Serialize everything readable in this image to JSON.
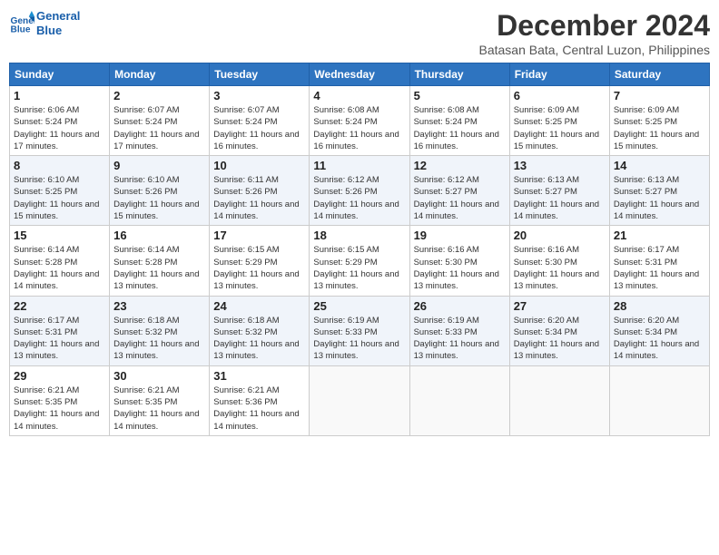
{
  "header": {
    "logo_line1": "General",
    "logo_line2": "Blue",
    "month_title": "December 2024",
    "subtitle": "Batasan Bata, Central Luzon, Philippines"
  },
  "weekdays": [
    "Sunday",
    "Monday",
    "Tuesday",
    "Wednesday",
    "Thursday",
    "Friday",
    "Saturday"
  ],
  "weeks": [
    [
      {
        "day": "1",
        "sunrise": "6:06 AM",
        "sunset": "5:24 PM",
        "daylight": "11 hours and 17 minutes."
      },
      {
        "day": "2",
        "sunrise": "6:07 AM",
        "sunset": "5:24 PM",
        "daylight": "11 hours and 17 minutes."
      },
      {
        "day": "3",
        "sunrise": "6:07 AM",
        "sunset": "5:24 PM",
        "daylight": "11 hours and 16 minutes."
      },
      {
        "day": "4",
        "sunrise": "6:08 AM",
        "sunset": "5:24 PM",
        "daylight": "11 hours and 16 minutes."
      },
      {
        "day": "5",
        "sunrise": "6:08 AM",
        "sunset": "5:24 PM",
        "daylight": "11 hours and 16 minutes."
      },
      {
        "day": "6",
        "sunrise": "6:09 AM",
        "sunset": "5:25 PM",
        "daylight": "11 hours and 15 minutes."
      },
      {
        "day": "7",
        "sunrise": "6:09 AM",
        "sunset": "5:25 PM",
        "daylight": "11 hours and 15 minutes."
      }
    ],
    [
      {
        "day": "8",
        "sunrise": "6:10 AM",
        "sunset": "5:25 PM",
        "daylight": "11 hours and 15 minutes."
      },
      {
        "day": "9",
        "sunrise": "6:10 AM",
        "sunset": "5:26 PM",
        "daylight": "11 hours and 15 minutes."
      },
      {
        "day": "10",
        "sunrise": "6:11 AM",
        "sunset": "5:26 PM",
        "daylight": "11 hours and 14 minutes."
      },
      {
        "day": "11",
        "sunrise": "6:12 AM",
        "sunset": "5:26 PM",
        "daylight": "11 hours and 14 minutes."
      },
      {
        "day": "12",
        "sunrise": "6:12 AM",
        "sunset": "5:27 PM",
        "daylight": "11 hours and 14 minutes."
      },
      {
        "day": "13",
        "sunrise": "6:13 AM",
        "sunset": "5:27 PM",
        "daylight": "11 hours and 14 minutes."
      },
      {
        "day": "14",
        "sunrise": "6:13 AM",
        "sunset": "5:27 PM",
        "daylight": "11 hours and 14 minutes."
      }
    ],
    [
      {
        "day": "15",
        "sunrise": "6:14 AM",
        "sunset": "5:28 PM",
        "daylight": "11 hours and 14 minutes."
      },
      {
        "day": "16",
        "sunrise": "6:14 AM",
        "sunset": "5:28 PM",
        "daylight": "11 hours and 13 minutes."
      },
      {
        "day": "17",
        "sunrise": "6:15 AM",
        "sunset": "5:29 PM",
        "daylight": "11 hours and 13 minutes."
      },
      {
        "day": "18",
        "sunrise": "6:15 AM",
        "sunset": "5:29 PM",
        "daylight": "11 hours and 13 minutes."
      },
      {
        "day": "19",
        "sunrise": "6:16 AM",
        "sunset": "5:30 PM",
        "daylight": "11 hours and 13 minutes."
      },
      {
        "day": "20",
        "sunrise": "6:16 AM",
        "sunset": "5:30 PM",
        "daylight": "11 hours and 13 minutes."
      },
      {
        "day": "21",
        "sunrise": "6:17 AM",
        "sunset": "5:31 PM",
        "daylight": "11 hours and 13 minutes."
      }
    ],
    [
      {
        "day": "22",
        "sunrise": "6:17 AM",
        "sunset": "5:31 PM",
        "daylight": "11 hours and 13 minutes."
      },
      {
        "day": "23",
        "sunrise": "6:18 AM",
        "sunset": "5:32 PM",
        "daylight": "11 hours and 13 minutes."
      },
      {
        "day": "24",
        "sunrise": "6:18 AM",
        "sunset": "5:32 PM",
        "daylight": "11 hours and 13 minutes."
      },
      {
        "day": "25",
        "sunrise": "6:19 AM",
        "sunset": "5:33 PM",
        "daylight": "11 hours and 13 minutes."
      },
      {
        "day": "26",
        "sunrise": "6:19 AM",
        "sunset": "5:33 PM",
        "daylight": "11 hours and 13 minutes."
      },
      {
        "day": "27",
        "sunrise": "6:20 AM",
        "sunset": "5:34 PM",
        "daylight": "11 hours and 13 minutes."
      },
      {
        "day": "28",
        "sunrise": "6:20 AM",
        "sunset": "5:34 PM",
        "daylight": "11 hours and 14 minutes."
      }
    ],
    [
      {
        "day": "29",
        "sunrise": "6:21 AM",
        "sunset": "5:35 PM",
        "daylight": "11 hours and 14 minutes."
      },
      {
        "day": "30",
        "sunrise": "6:21 AM",
        "sunset": "5:35 PM",
        "daylight": "11 hours and 14 minutes."
      },
      {
        "day": "31",
        "sunrise": "6:21 AM",
        "sunset": "5:36 PM",
        "daylight": "11 hours and 14 minutes."
      },
      null,
      null,
      null,
      null
    ]
  ]
}
